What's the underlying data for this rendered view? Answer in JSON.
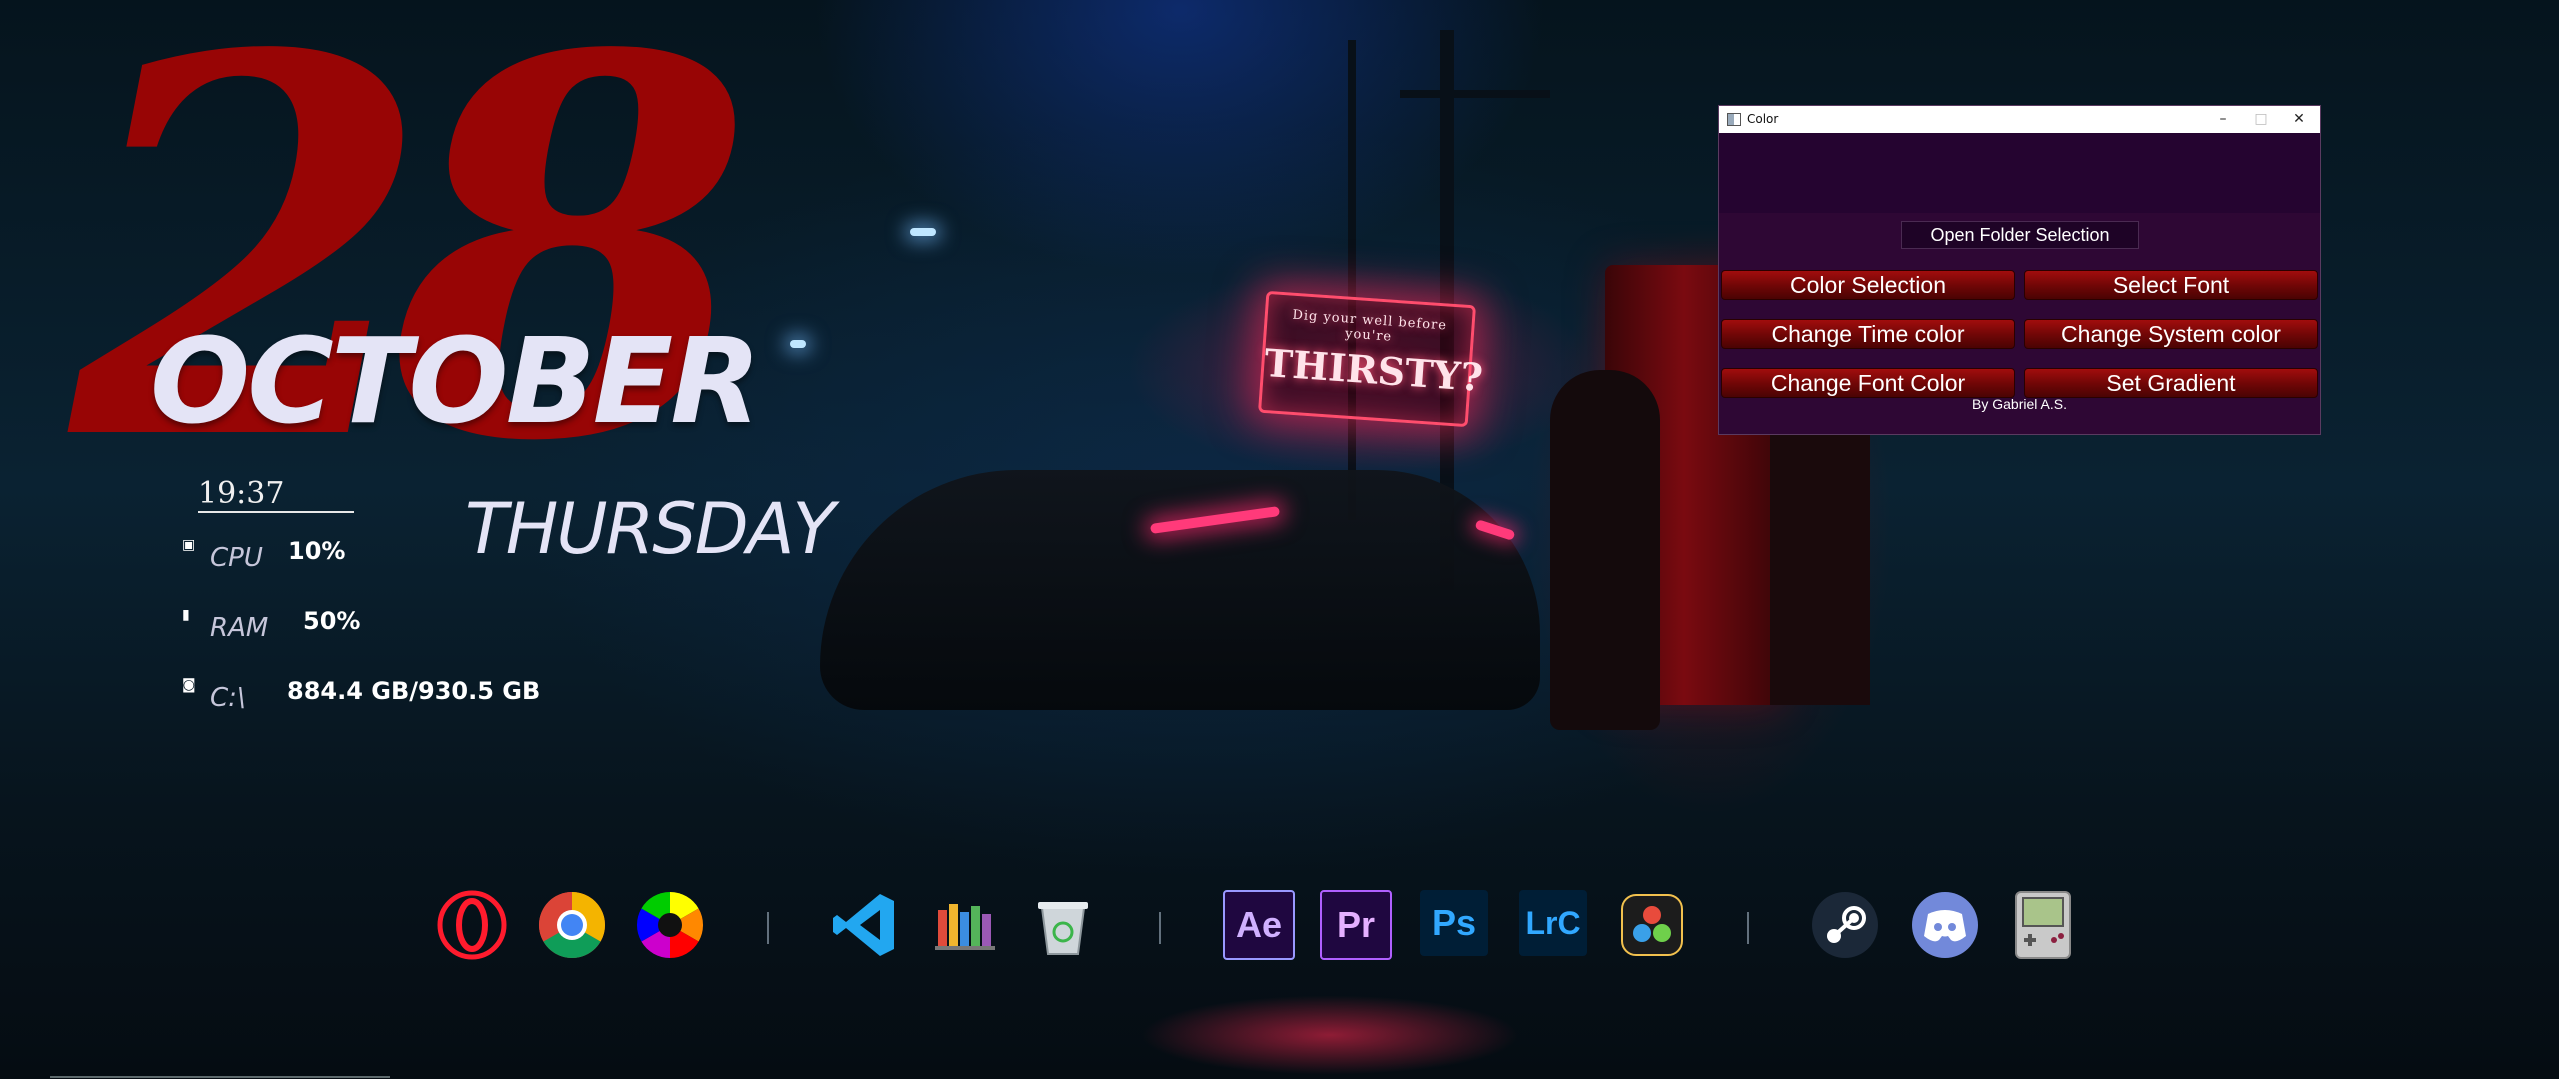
{
  "wallpaper": {
    "sign_small": "Dig your well before you're",
    "sign_big": "THIRSTY?"
  },
  "date_widget": {
    "day": "28",
    "month": "October",
    "weekday": "Thursday",
    "time": "19:37"
  },
  "system_stats": [
    {
      "label": "CPU",
      "value": "10%",
      "icon": "cpu-icon"
    },
    {
      "label": "RAM",
      "value": "50%",
      "icon": "ram-icon"
    },
    {
      "label": "C:\\",
      "value": "884.4 GB/930.5 GB",
      "icon": "drive-icon"
    }
  ],
  "color_window": {
    "title": "Color",
    "minimize": "–",
    "maximize": "□",
    "close": "✕",
    "open_folder_label": "Open Folder Selection",
    "buttons": {
      "color_selection": "Color Selection",
      "select_font": "Select Font",
      "change_time_color": "Change Time color",
      "change_system_color": "Change System color",
      "change_font_color": "Change Font Color",
      "set_gradient": "Set Gradient"
    },
    "credit": "By Gabriel A.S.",
    "colors": {
      "background": "#2e0734",
      "button": "#8b0a0a"
    }
  },
  "dock": {
    "ae": "Ae",
    "pr": "Pr",
    "ps": "Ps",
    "lrc": "LrC",
    "items": [
      "opera",
      "chrome",
      "color-wheel",
      "vscode",
      "library",
      "recycle-bin",
      "after-effects",
      "premiere-pro",
      "photoshop",
      "lightroom-classic",
      "davinci-resolve",
      "steam",
      "discord",
      "gameboy-emulator"
    ]
  }
}
